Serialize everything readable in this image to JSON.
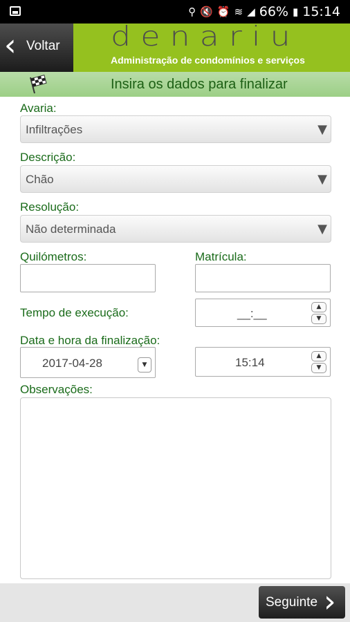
{
  "status_bar": {
    "battery": "66%",
    "time": "15:14"
  },
  "header": {
    "back_label": "Voltar",
    "logo_text": "denariu",
    "tagline": "Administração de condomínios e serviços"
  },
  "banner": {
    "text": "Insira os dados para finalizar"
  },
  "form": {
    "avaria": {
      "label": "Avaria:",
      "value": "Infiltrações"
    },
    "descricao": {
      "label": "Descrição:",
      "value": "Chão"
    },
    "resolucao": {
      "label": "Resolução:",
      "value": "Não determinada"
    },
    "quilometros": {
      "label": "Quilómetros:",
      "value": ""
    },
    "matricula": {
      "label": "Matrícula:",
      "value": ""
    },
    "tempo": {
      "label": "Tempo de execução:",
      "value": "__:__"
    },
    "data_hora": {
      "label": "Data e hora da finalização:",
      "date": "2017-04-28",
      "time": "15:14"
    },
    "observacoes": {
      "label": "Observações:",
      "value": ""
    }
  },
  "footer": {
    "next_label": "Seguinte"
  },
  "colors": {
    "header_green": "#95c11f",
    "label_green": "#1a6b1a",
    "banner_green": "#9ccf86"
  }
}
